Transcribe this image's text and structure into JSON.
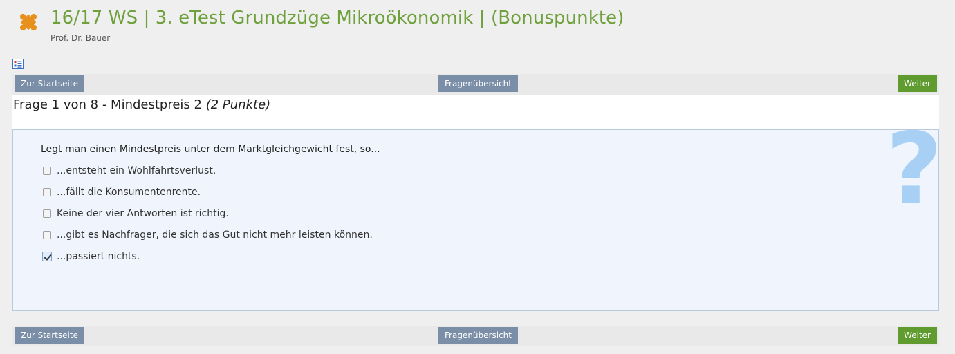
{
  "header": {
    "title": "16/17 WS | 3. eTest Grundzüge Mikroökonomik | (Bonuspunkte)",
    "subtitle": "Prof. Dr. Bauer",
    "accent_color": "#6ea03c",
    "logo_icon": "puzzle-icon"
  },
  "nav": {
    "start_label": "Zur Startseite",
    "overview_label": "Fragenübersicht",
    "next_label": "Weiter"
  },
  "question": {
    "heading": "Frage 1 von 8 - Mindestpreis 2",
    "points": "(2 Punkte)",
    "text": "Legt man einen Mindestpreis unter dem Marktgleichgewicht fest, so...",
    "answers": [
      {
        "label": "...entsteht ein Wohlfahrtsverlust.",
        "checked": false
      },
      {
        "label": "...fällt die Konsumentenrente.",
        "checked": false
      },
      {
        "label": "Keine der vier Antworten ist richtig.",
        "checked": false
      },
      {
        "label": "...gibt es Nachfrager, die sich das Gut nicht mehr leisten können.",
        "checked": false
      },
      {
        "label": "...passiert nichts.",
        "checked": true
      }
    ],
    "decoration_icon": "question-mark-icon"
  }
}
